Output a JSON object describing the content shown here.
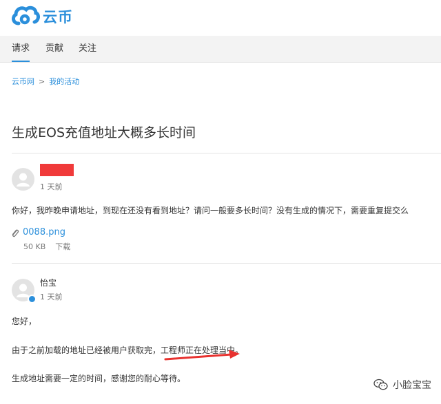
{
  "brand": {
    "name": "云币"
  },
  "nav": {
    "tabs": [
      {
        "label": "请求",
        "active": true
      },
      {
        "label": "贡献"
      },
      {
        "label": "关注"
      }
    ]
  },
  "breadcrumb": {
    "home": "云币网",
    "separator": ">",
    "current": "我的活动"
  },
  "page": {
    "title": "生成EOS充值地址大概多长时间"
  },
  "post": {
    "time": "1 天前",
    "body": "你好，我昨晚申请地址，到现在还没有看到地址？请问一般要多长时间？没有生成的情况下，需要重复提交么",
    "attachment": {
      "name": "0088.png",
      "size": "50 KB",
      "download": "下载"
    }
  },
  "reply": {
    "author": "怡宝",
    "time": "1 天前",
    "lines": [
      "您好，",
      "由于之前加载的地址已经被用户获取完，工程师正在处理当中。",
      "生成地址需要一定的时间，感谢您的耐心等待。"
    ]
  },
  "watermark": {
    "text": "小脸宝宝"
  },
  "colors": {
    "accent": "#2b8fdb",
    "redaction": "#f03a3a",
    "arrow": "#e8322f"
  }
}
